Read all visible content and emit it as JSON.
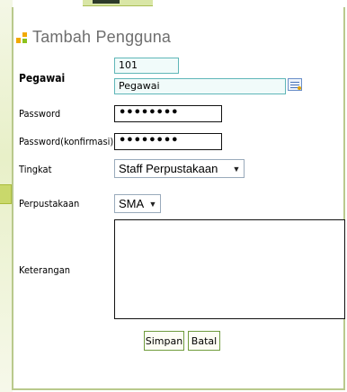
{
  "dialog": {
    "title": "Tambah Pengguna"
  },
  "form": {
    "pegawai": {
      "label": "Pegawai",
      "id_value": "101",
      "name_value": "Pegawai"
    },
    "password": {
      "label": "Password",
      "value": "••••••••"
    },
    "password_confirm": {
      "label": "Password(konfirmasi)",
      "value": "••••••••"
    },
    "tingkat": {
      "label": "Tingkat",
      "selected": "Staff Perpustakaan"
    },
    "perpustakaan": {
      "label": "Perpustakaan",
      "selected": "SMA"
    },
    "keterangan": {
      "label": "Keterangan",
      "value": ""
    }
  },
  "buttons": {
    "save": "Simpan",
    "cancel": "Batal"
  },
  "colors": {
    "accent_green": "#8cc21d",
    "accent_orange": "#f2a900",
    "field_border_teal": "#5fb6b8",
    "panel_border": "#b9c98c"
  },
  "icons": {
    "title": "windows-squares-icon",
    "lookup": "lookup-list-icon",
    "dropdown": "chevron-down-icon"
  }
}
